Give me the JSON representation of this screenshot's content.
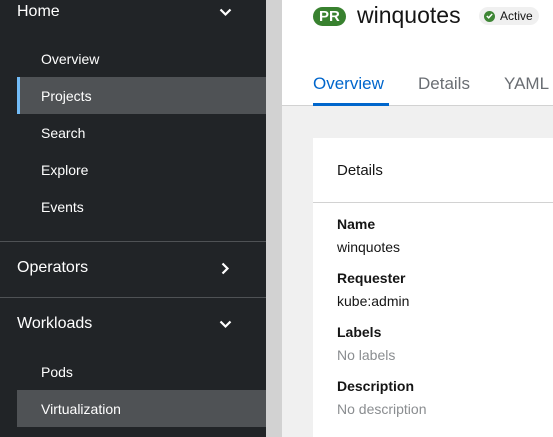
{
  "sidebar": {
    "groups": [
      {
        "label": "Home",
        "icon": "chevron-down-icon"
      },
      {
        "label": "Operators",
        "icon": "chevron-right-icon"
      },
      {
        "label": "Workloads",
        "icon": "chevron-down-icon"
      }
    ],
    "home_items": [
      {
        "label": "Overview"
      },
      {
        "label": "Projects"
      },
      {
        "label": "Search"
      },
      {
        "label": "Explore"
      },
      {
        "label": "Events"
      }
    ],
    "workload_items": [
      {
        "label": "Pods"
      },
      {
        "label": "Virtualization"
      }
    ]
  },
  "header": {
    "badge": "PR",
    "title": "winquotes",
    "status": "Active",
    "status_icon": "check-circle-icon",
    "status_color": "#3e8635"
  },
  "tabs": [
    {
      "label": "Overview"
    },
    {
      "label": "Details"
    },
    {
      "label": "YAML"
    }
  ],
  "details": {
    "title": "Details",
    "fields": [
      {
        "label": "Name",
        "value": "winquotes"
      },
      {
        "label": "Requester",
        "value": "kube:admin"
      },
      {
        "label": "Labels",
        "value": "No labels"
      },
      {
        "label": "Description",
        "value": "No description"
      }
    ]
  },
  "colors": {
    "accent": "#0066cc",
    "sidebar_bg": "#212427",
    "badge_bg": "#38812f"
  }
}
